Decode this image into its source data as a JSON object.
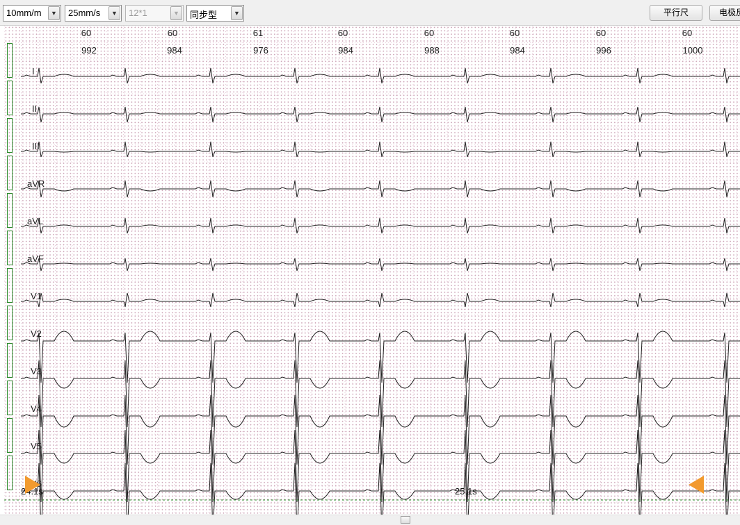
{
  "toolbar": {
    "gain": "10mm/m",
    "speed": "25mm/s",
    "layout": "12*1",
    "mode": "同步型",
    "ruler_button": "平行尺",
    "electrode_button": "电极反"
  },
  "heart_rates": [
    "60",
    "60",
    "61",
    "60",
    "60",
    "60",
    "60",
    "60"
  ],
  "rr_intervals": [
    "992",
    "984",
    "976",
    "984",
    "988",
    "984",
    "996",
    "1000"
  ],
  "leads": [
    "I",
    "II",
    "III",
    "aVR",
    "aVL",
    "aVF",
    "V1",
    "V2",
    "V3",
    "V4",
    "V5",
    "V6"
  ],
  "time_labels": [
    "24.1s",
    "25.1s"
  ],
  "colors": {
    "marker": "#f29a2e",
    "bracket": "#2a8a2a",
    "grid": "#c89bb0",
    "trace": "#222222"
  }
}
